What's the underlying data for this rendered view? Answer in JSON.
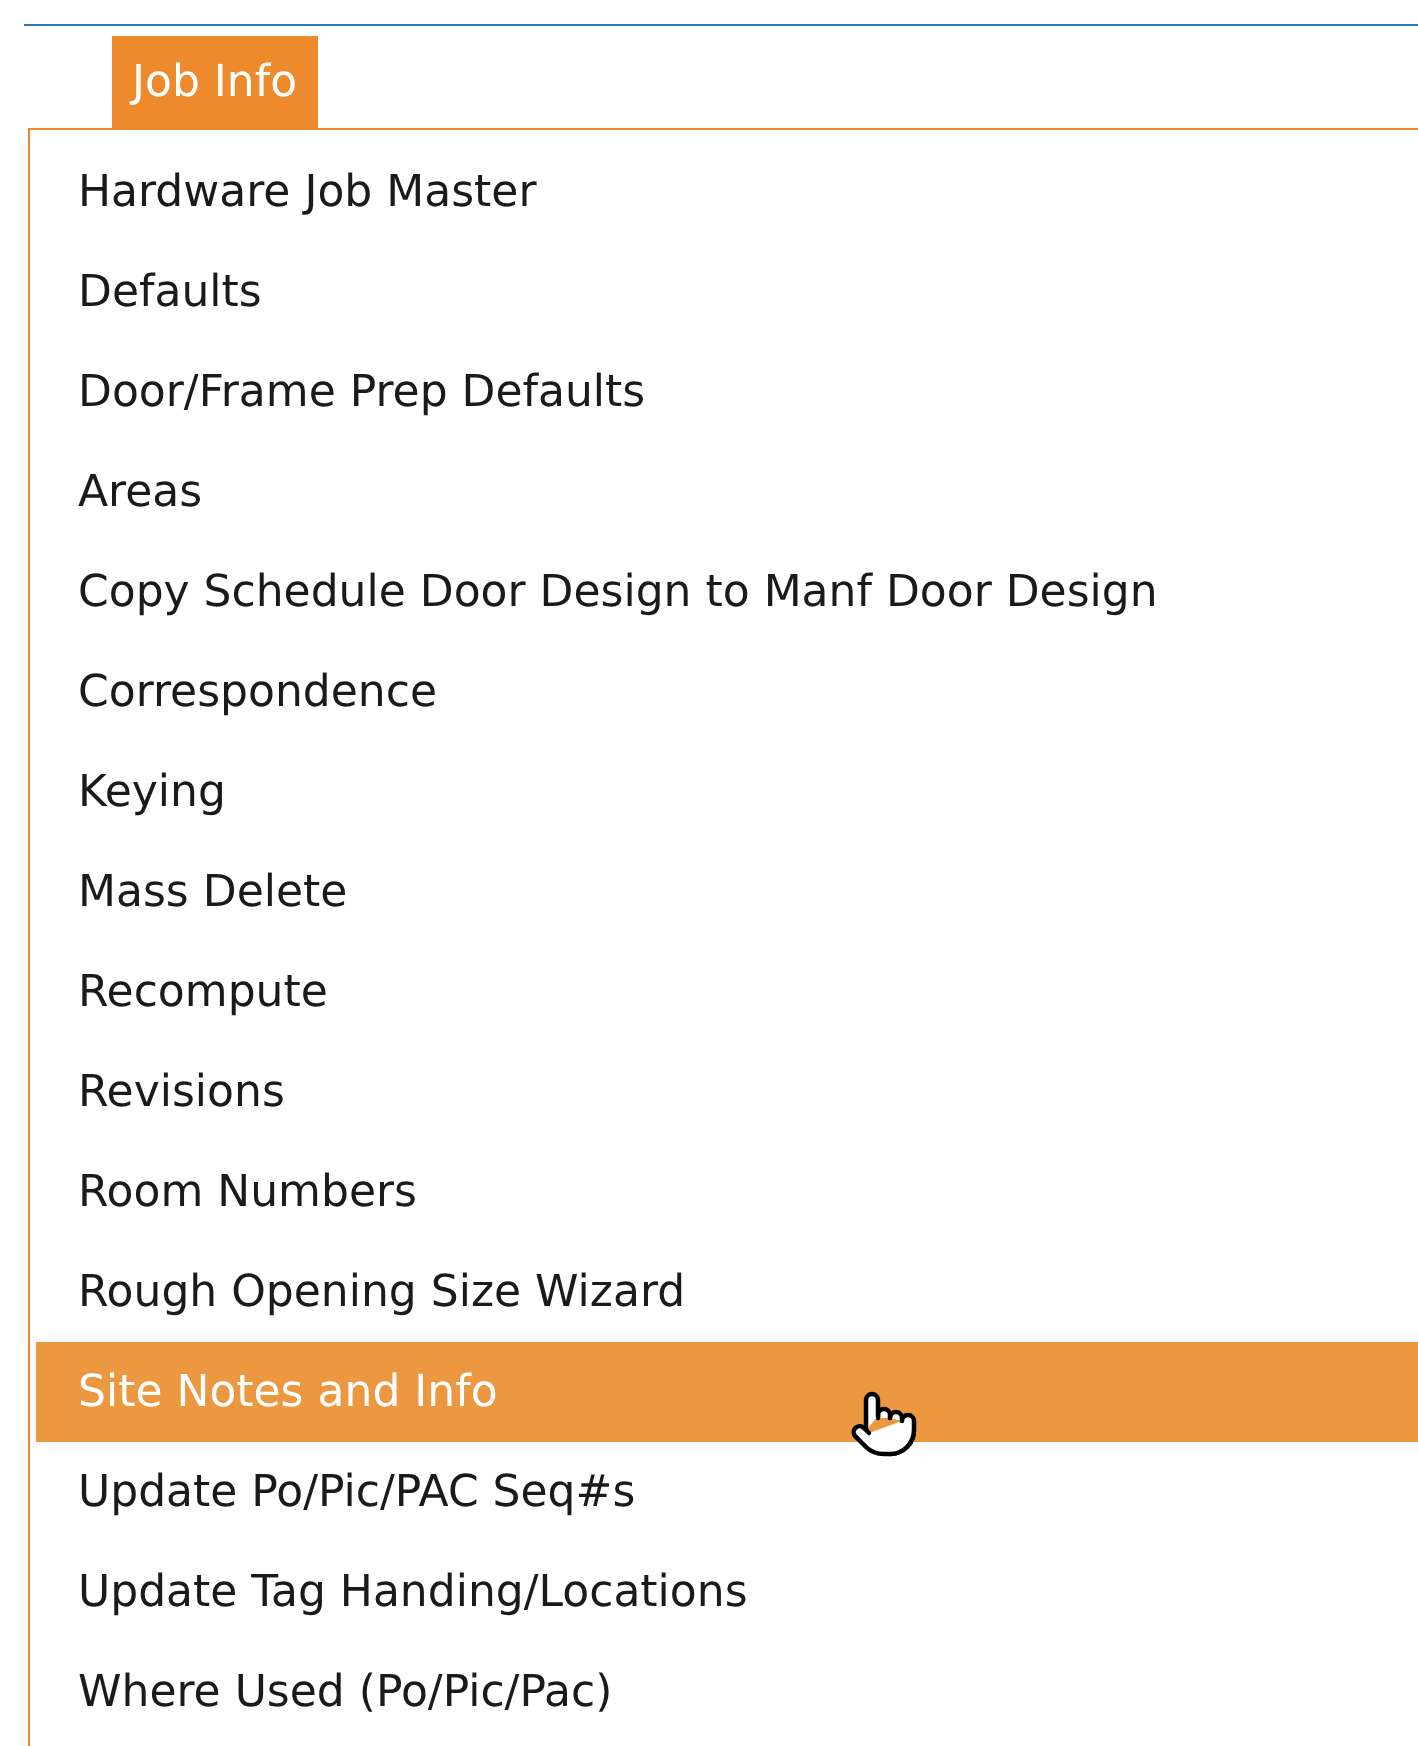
{
  "menu_tab": {
    "label": "Job Info",
    "selected": true
  },
  "menu_items": [
    {
      "label": "Hardware Job Master",
      "selected": false
    },
    {
      "label": "Defaults",
      "selected": false
    },
    {
      "label": "Door/Frame Prep Defaults",
      "selected": false
    },
    {
      "label": "Areas",
      "selected": false
    },
    {
      "label": "Copy Schedule Door Design to Manf Door Design",
      "selected": false
    },
    {
      "label": "Correspondence",
      "selected": false
    },
    {
      "label": "Keying",
      "selected": false
    },
    {
      "label": "Mass Delete",
      "selected": false
    },
    {
      "label": "Recompute",
      "selected": false
    },
    {
      "label": "Revisions",
      "selected": false
    },
    {
      "label": "Room Numbers",
      "selected": false
    },
    {
      "label": "Rough Opening Size Wizard",
      "selected": false
    },
    {
      "label": "Site Notes and Info",
      "selected": true
    },
    {
      "label": "Update Po/Pic/PAC Seq#s",
      "selected": false
    },
    {
      "label": "Update Tag Handing/Locations",
      "selected": false
    },
    {
      "label": "Where Used (Po/Pic/Pac)",
      "selected": false
    }
  ]
}
